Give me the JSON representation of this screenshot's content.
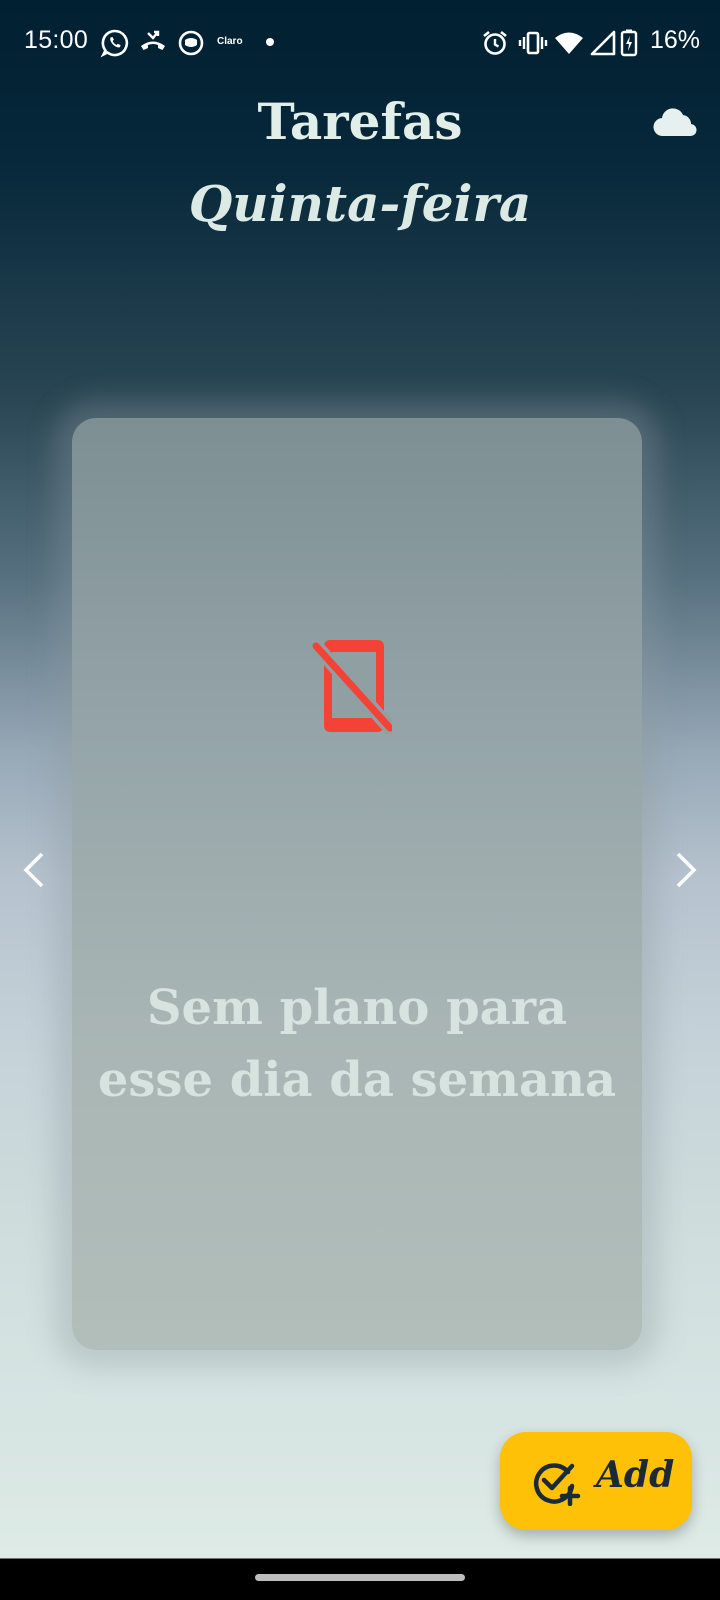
{
  "status_bar": {
    "time": "15:00",
    "carrier": "Claro",
    "battery_percent": "16%",
    "left_icons": [
      "whatsapp-icon",
      "missed-call-icon",
      "assistant-face-icon",
      "claro-icon"
    ],
    "right_icons": [
      "alarm-icon",
      "vibrate-icon",
      "wifi-icon",
      "signal-icon",
      "battery-charging-icon"
    ]
  },
  "header": {
    "title": "Tarefas",
    "day": "Quinta-feira",
    "sync_icon": "cloud-icon"
  },
  "card": {
    "icon": "mobile-off-icon",
    "message": "Sem plano para esse dia da semana"
  },
  "navigation": {
    "prev_icon": "chevron-left-icon",
    "next_icon": "chevron-right-icon"
  },
  "fab": {
    "label": "Add",
    "icon": "add-task-icon"
  },
  "colors": {
    "accent": "#ffc107",
    "error_icon": "#f44336",
    "header_bg": "#012032",
    "text_light": "#e2efe9"
  }
}
